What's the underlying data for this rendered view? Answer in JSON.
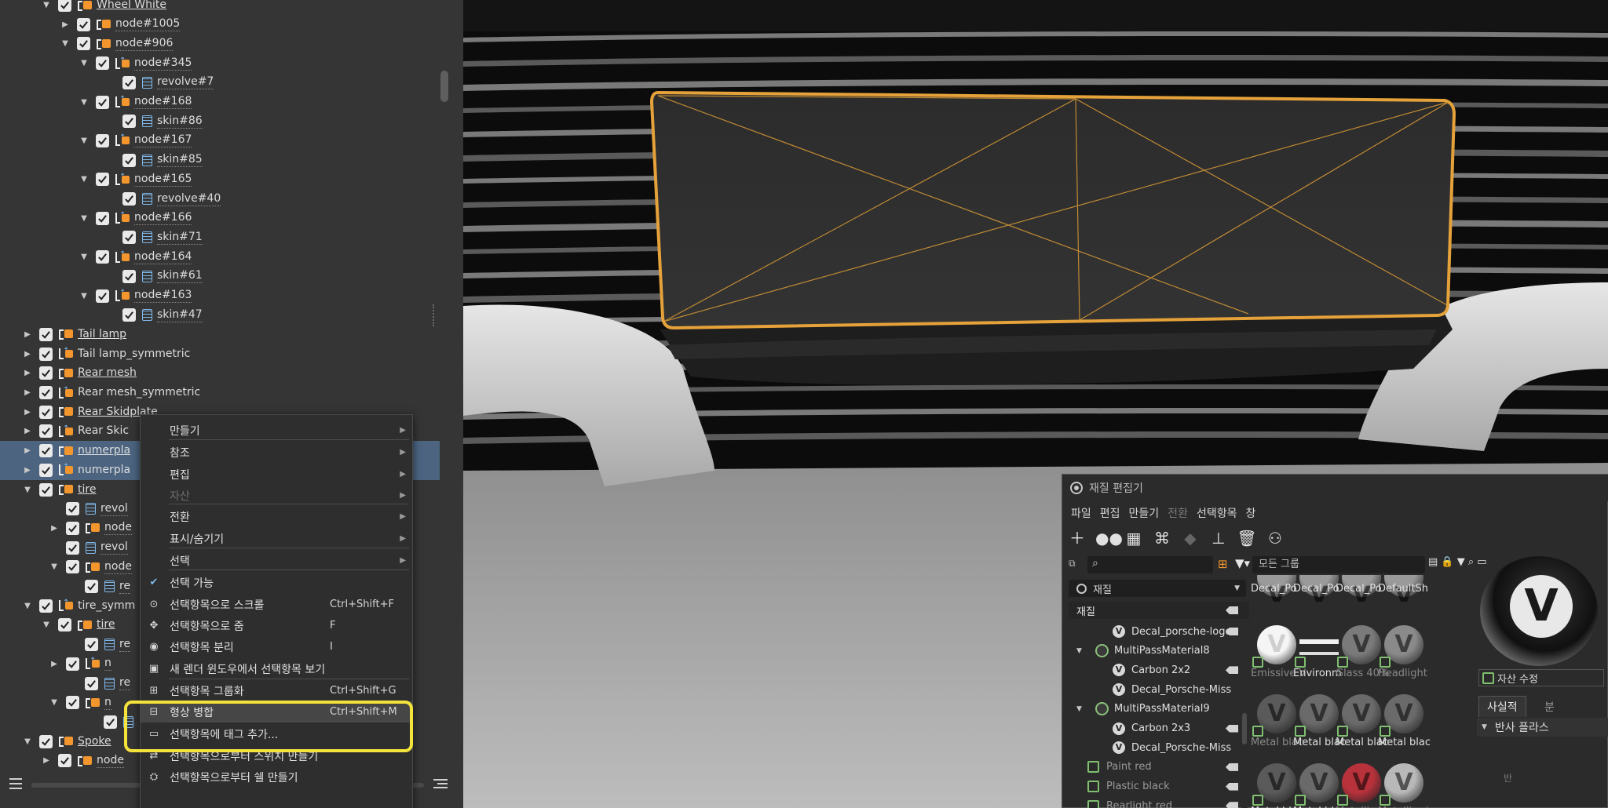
{
  "tree": {
    "items": [
      {
        "label": "Wheel White",
        "expand": "down",
        "icon": "group",
        "style": "u"
      },
      {
        "label": "node#1005",
        "expand": "right",
        "icon": "group",
        "style": "d"
      },
      {
        "label": "node#906",
        "expand": "down",
        "icon": "group",
        "style": "d"
      },
      {
        "label": "node#345",
        "expand": "down",
        "icon": "link",
        "style": "d"
      },
      {
        "label": "revolve#7",
        "expand": "none",
        "icon": "surface",
        "style": "d"
      },
      {
        "label": "node#168",
        "expand": "down",
        "icon": "link",
        "style": "d"
      },
      {
        "label": "skin#86",
        "expand": "none",
        "icon": "surface",
        "style": "d"
      },
      {
        "label": "node#167",
        "expand": "down",
        "icon": "link",
        "style": "d"
      },
      {
        "label": "skin#85",
        "expand": "none",
        "icon": "surface",
        "style": "d"
      },
      {
        "label": "node#165",
        "expand": "down",
        "icon": "link",
        "style": "d"
      },
      {
        "label": "revolve#40",
        "expand": "none",
        "icon": "surface",
        "style": "d"
      },
      {
        "label": "node#166",
        "expand": "down",
        "icon": "link",
        "style": "d"
      },
      {
        "label": "skin#71",
        "expand": "none",
        "icon": "surface",
        "style": "d"
      },
      {
        "label": "node#164",
        "expand": "down",
        "icon": "link",
        "style": "d"
      },
      {
        "label": "skin#61",
        "expand": "none",
        "icon": "surface",
        "style": "d"
      },
      {
        "label": "node#163",
        "expand": "down",
        "icon": "link",
        "style": "d"
      },
      {
        "label": "skin#47",
        "expand": "none",
        "icon": "surface",
        "style": "d"
      },
      {
        "label": "Tail lamp",
        "expand": "right",
        "icon": "group",
        "style": "u"
      },
      {
        "label": "Tail lamp_symmetric",
        "expand": "right",
        "icon": "link",
        "style": "n"
      },
      {
        "label": "Rear mesh",
        "expand": "right",
        "icon": "group",
        "style": "u"
      },
      {
        "label": "Rear mesh_symmetric",
        "expand": "right",
        "icon": "link",
        "style": "n"
      },
      {
        "label": "Rear Skidplate",
        "expand": "right",
        "icon": "group",
        "style": "u"
      },
      {
        "label": "Rear Skic",
        "expand": "right",
        "icon": "link",
        "style": "n"
      },
      {
        "label": "numerpla",
        "expand": "right",
        "icon": "group",
        "style": "u"
      },
      {
        "label": "numerpla",
        "expand": "right",
        "icon": "link",
        "style": "n"
      },
      {
        "label": "tire",
        "expand": "down",
        "icon": "group",
        "style": "u"
      },
      {
        "label": "revol",
        "expand": "none",
        "icon": "surface",
        "style": "d"
      },
      {
        "label": "node",
        "expand": "right",
        "icon": "group",
        "style": "d"
      },
      {
        "label": "revol",
        "expand": "none",
        "icon": "surface",
        "style": "d"
      },
      {
        "label": "node",
        "expand": "down",
        "icon": "group",
        "style": "d"
      },
      {
        "label": "re",
        "expand": "none",
        "icon": "surface",
        "style": "d"
      },
      {
        "label": "tire_symm",
        "expand": "down",
        "icon": "link",
        "style": "n"
      },
      {
        "label": "tire",
        "expand": "down",
        "icon": "group",
        "style": "u"
      },
      {
        "label": "re",
        "expand": "none",
        "icon": "surface",
        "style": "d"
      },
      {
        "label": "n",
        "expand": "right",
        "icon": "link",
        "style": "d"
      },
      {
        "label": "re",
        "expand": "none",
        "icon": "surface",
        "style": "d"
      },
      {
        "label": "n",
        "expand": "down",
        "icon": "group",
        "style": "d"
      },
      {
        "label": "",
        "expand": "none",
        "icon": "surface",
        "style": "d"
      },
      {
        "label": "Spoke",
        "expand": "down",
        "icon": "group",
        "style": "u"
      },
      {
        "label": "node",
        "expand": "right",
        "icon": "group",
        "style": "d"
      }
    ]
  },
  "context_menu": {
    "items": [
      {
        "label": "만들기",
        "shortcut": "",
        "icon": "",
        "submenu": true,
        "disabled": false
      },
      {
        "label": "참조",
        "shortcut": "",
        "icon": "",
        "submenu": true,
        "disabled": false
      },
      {
        "label": "편집",
        "shortcut": "",
        "icon": "",
        "submenu": true,
        "disabled": false
      },
      {
        "label": "자산",
        "shortcut": "",
        "icon": "",
        "submenu": true,
        "disabled": true
      },
      {
        "label": "전환",
        "shortcut": "",
        "icon": "",
        "submenu": true,
        "disabled": false
      },
      {
        "label": "표시/숨기기",
        "shortcut": "",
        "icon": "",
        "submenu": true,
        "disabled": false
      },
      {
        "label": "선택",
        "shortcut": "",
        "icon": "",
        "submenu": true,
        "disabled": false
      },
      {
        "label": "선택 가능",
        "shortcut": "",
        "icon": "check",
        "submenu": false,
        "disabled": false
      },
      {
        "label": "선택항목으로 스크롤",
        "shortcut": "Ctrl+Shift+F",
        "icon": "scroll",
        "submenu": false,
        "disabled": false
      },
      {
        "label": "선택항목으로 줌",
        "shortcut": "F",
        "icon": "zoom",
        "submenu": false,
        "disabled": false
      },
      {
        "label": "선택항목 분리",
        "shortcut": "I",
        "icon": "isolate",
        "submenu": false,
        "disabled": false
      },
      {
        "label": "새 렌더 윈도우에서 선택항목 보기",
        "shortcut": "",
        "icon": "render",
        "submenu": false,
        "disabled": false
      },
      {
        "label": "선택항목 그룹화",
        "shortcut": "Ctrl+Shift+G",
        "icon": "group",
        "submenu": false,
        "disabled": false
      },
      {
        "label": "형상 병합",
        "shortcut": "Ctrl+Shift+M",
        "icon": "merge",
        "submenu": false,
        "disabled": false,
        "highlighted": true
      },
      {
        "label": "선택항목에 태그 추가...",
        "shortcut": "",
        "icon": "tag",
        "submenu": false,
        "disabled": false
      },
      {
        "label": "선택항목으로부터 스위치 만들기",
        "shortcut": "",
        "icon": "switch",
        "submenu": false,
        "disabled": false
      },
      {
        "label": "선택항목으로부터 쉘 만들기",
        "shortcut": "",
        "icon": "shell",
        "submenu": false,
        "disabled": false
      }
    ]
  },
  "material_editor": {
    "title": "재질 편집기",
    "menu": [
      "파일",
      "편집",
      "만들기",
      "전환",
      "선택항목",
      "창"
    ],
    "menu_disabled": [
      false,
      false,
      false,
      true,
      false,
      false
    ],
    "search_placeholder": "",
    "combo": "재질",
    "list_header": "재질",
    "group_filter": "모든 그룹",
    "list": [
      {
        "label": "Decal_porsche-logo",
        "indent": 2,
        "kind": "v",
        "exp": ""
      },
      {
        "label": "MultiPassMaterial8",
        "indent": 1,
        "kind": "multi",
        "exp": "down"
      },
      {
        "label": "Carbon 2x2",
        "indent": 2,
        "kind": "v",
        "exp": ""
      },
      {
        "label": "Decal_Porsche-Miss",
        "indent": 2,
        "kind": "v",
        "exp": ""
      },
      {
        "label": "MultiPassMaterial9",
        "indent": 1,
        "kind": "multi",
        "exp": "down"
      },
      {
        "label": "Carbon 2x3",
        "indent": 2,
        "kind": "v",
        "exp": ""
      },
      {
        "label": "Decal_Porsche-Miss",
        "indent": 2,
        "kind": "v",
        "exp": ""
      },
      {
        "label": "Paint red",
        "indent": 1,
        "kind": "sq",
        "exp": "",
        "dim": true
      },
      {
        "label": "Plastic black",
        "indent": 1,
        "kind": "sq",
        "exp": "",
        "dim": true
      },
      {
        "label": "Rearlight red",
        "indent": 1,
        "kind": "sq",
        "exp": "",
        "dim": true
      }
    ],
    "swatches": [
      {
        "name": "Decal_Po",
        "color": "#9a9a9a",
        "row": 0
      },
      {
        "name": "Decal_Po",
        "color": "#9a9a9a",
        "row": 0
      },
      {
        "name": "Decal_Po",
        "color": "#9a9a9a",
        "row": 0
      },
      {
        "name": "DefaultSh",
        "color": "#9a9a9a",
        "row": 0
      },
      {
        "name": "Emissive V",
        "color": "#f5f5f5",
        "row": 1,
        "dim": true
      },
      {
        "name": "Environm",
        "color": "env",
        "row": 1
      },
      {
        "name": "Glass 40%",
        "color": "#7a7a7a",
        "row": 1,
        "dim": true
      },
      {
        "name": "Headlight",
        "color": "#8a8a8a",
        "row": 1,
        "dim": true
      },
      {
        "name": "Metal blac",
        "color": "#5a5a5a",
        "row": 2,
        "dim": true
      },
      {
        "name": "Metal blac",
        "color": "#6a6a6a",
        "row": 2
      },
      {
        "name": "Metal blac",
        "color": "#6a6a6a",
        "row": 2
      },
      {
        "name": "Metal blac",
        "color": "#6a6a6a",
        "row": 2
      },
      {
        "name": "Metal blac",
        "color": "#5a5a5a",
        "row": 3
      },
      {
        "name": "Metal blac",
        "color": "#6a6a6a",
        "row": 3
      },
      {
        "name": "Metallic re",
        "color": "#b8323c",
        "row": 3,
        "dim": true
      },
      {
        "name": "Metallic si",
        "color": "#b8b8b8",
        "row": 3,
        "dim": true
      }
    ],
    "preview": {
      "checkbox_label": "자산 수정",
      "tab1": "사실적",
      "tab2": "분",
      "section": "반사 플라스",
      "field": "반"
    }
  }
}
